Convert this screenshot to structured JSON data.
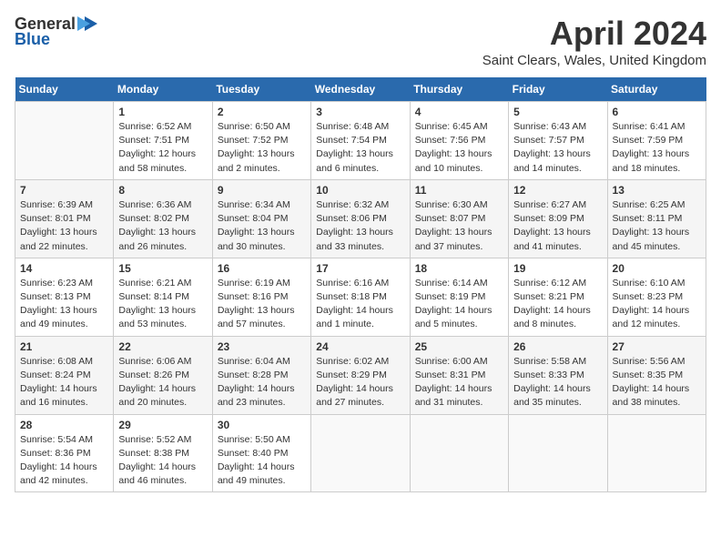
{
  "header": {
    "logo_general": "General",
    "logo_blue": "Blue",
    "title": "April 2024",
    "subtitle": "Saint Clears, Wales, United Kingdom"
  },
  "weekdays": [
    "Sunday",
    "Monday",
    "Tuesday",
    "Wednesday",
    "Thursday",
    "Friday",
    "Saturday"
  ],
  "weeks": [
    [
      {
        "num": "",
        "sunrise": "",
        "sunset": "",
        "daylight": ""
      },
      {
        "num": "1",
        "sunrise": "Sunrise: 6:52 AM",
        "sunset": "Sunset: 7:51 PM",
        "daylight": "Daylight: 12 hours and 58 minutes."
      },
      {
        "num": "2",
        "sunrise": "Sunrise: 6:50 AM",
        "sunset": "Sunset: 7:52 PM",
        "daylight": "Daylight: 13 hours and 2 minutes."
      },
      {
        "num": "3",
        "sunrise": "Sunrise: 6:48 AM",
        "sunset": "Sunset: 7:54 PM",
        "daylight": "Daylight: 13 hours and 6 minutes."
      },
      {
        "num": "4",
        "sunrise": "Sunrise: 6:45 AM",
        "sunset": "Sunset: 7:56 PM",
        "daylight": "Daylight: 13 hours and 10 minutes."
      },
      {
        "num": "5",
        "sunrise": "Sunrise: 6:43 AM",
        "sunset": "Sunset: 7:57 PM",
        "daylight": "Daylight: 13 hours and 14 minutes."
      },
      {
        "num": "6",
        "sunrise": "Sunrise: 6:41 AM",
        "sunset": "Sunset: 7:59 PM",
        "daylight": "Daylight: 13 hours and 18 minutes."
      }
    ],
    [
      {
        "num": "7",
        "sunrise": "Sunrise: 6:39 AM",
        "sunset": "Sunset: 8:01 PM",
        "daylight": "Daylight: 13 hours and 22 minutes."
      },
      {
        "num": "8",
        "sunrise": "Sunrise: 6:36 AM",
        "sunset": "Sunset: 8:02 PM",
        "daylight": "Daylight: 13 hours and 26 minutes."
      },
      {
        "num": "9",
        "sunrise": "Sunrise: 6:34 AM",
        "sunset": "Sunset: 8:04 PM",
        "daylight": "Daylight: 13 hours and 30 minutes."
      },
      {
        "num": "10",
        "sunrise": "Sunrise: 6:32 AM",
        "sunset": "Sunset: 8:06 PM",
        "daylight": "Daylight: 13 hours and 33 minutes."
      },
      {
        "num": "11",
        "sunrise": "Sunrise: 6:30 AM",
        "sunset": "Sunset: 8:07 PM",
        "daylight": "Daylight: 13 hours and 37 minutes."
      },
      {
        "num": "12",
        "sunrise": "Sunrise: 6:27 AM",
        "sunset": "Sunset: 8:09 PM",
        "daylight": "Daylight: 13 hours and 41 minutes."
      },
      {
        "num": "13",
        "sunrise": "Sunrise: 6:25 AM",
        "sunset": "Sunset: 8:11 PM",
        "daylight": "Daylight: 13 hours and 45 minutes."
      }
    ],
    [
      {
        "num": "14",
        "sunrise": "Sunrise: 6:23 AM",
        "sunset": "Sunset: 8:13 PM",
        "daylight": "Daylight: 13 hours and 49 minutes."
      },
      {
        "num": "15",
        "sunrise": "Sunrise: 6:21 AM",
        "sunset": "Sunset: 8:14 PM",
        "daylight": "Daylight: 13 hours and 53 minutes."
      },
      {
        "num": "16",
        "sunrise": "Sunrise: 6:19 AM",
        "sunset": "Sunset: 8:16 PM",
        "daylight": "Daylight: 13 hours and 57 minutes."
      },
      {
        "num": "17",
        "sunrise": "Sunrise: 6:16 AM",
        "sunset": "Sunset: 8:18 PM",
        "daylight": "Daylight: 14 hours and 1 minute."
      },
      {
        "num": "18",
        "sunrise": "Sunrise: 6:14 AM",
        "sunset": "Sunset: 8:19 PM",
        "daylight": "Daylight: 14 hours and 5 minutes."
      },
      {
        "num": "19",
        "sunrise": "Sunrise: 6:12 AM",
        "sunset": "Sunset: 8:21 PM",
        "daylight": "Daylight: 14 hours and 8 minutes."
      },
      {
        "num": "20",
        "sunrise": "Sunrise: 6:10 AM",
        "sunset": "Sunset: 8:23 PM",
        "daylight": "Daylight: 14 hours and 12 minutes."
      }
    ],
    [
      {
        "num": "21",
        "sunrise": "Sunrise: 6:08 AM",
        "sunset": "Sunset: 8:24 PM",
        "daylight": "Daylight: 14 hours and 16 minutes."
      },
      {
        "num": "22",
        "sunrise": "Sunrise: 6:06 AM",
        "sunset": "Sunset: 8:26 PM",
        "daylight": "Daylight: 14 hours and 20 minutes."
      },
      {
        "num": "23",
        "sunrise": "Sunrise: 6:04 AM",
        "sunset": "Sunset: 8:28 PM",
        "daylight": "Daylight: 14 hours and 23 minutes."
      },
      {
        "num": "24",
        "sunrise": "Sunrise: 6:02 AM",
        "sunset": "Sunset: 8:29 PM",
        "daylight": "Daylight: 14 hours and 27 minutes."
      },
      {
        "num": "25",
        "sunrise": "Sunrise: 6:00 AM",
        "sunset": "Sunset: 8:31 PM",
        "daylight": "Daylight: 14 hours and 31 minutes."
      },
      {
        "num": "26",
        "sunrise": "Sunrise: 5:58 AM",
        "sunset": "Sunset: 8:33 PM",
        "daylight": "Daylight: 14 hours and 35 minutes."
      },
      {
        "num": "27",
        "sunrise": "Sunrise: 5:56 AM",
        "sunset": "Sunset: 8:35 PM",
        "daylight": "Daylight: 14 hours and 38 minutes."
      }
    ],
    [
      {
        "num": "28",
        "sunrise": "Sunrise: 5:54 AM",
        "sunset": "Sunset: 8:36 PM",
        "daylight": "Daylight: 14 hours and 42 minutes."
      },
      {
        "num": "29",
        "sunrise": "Sunrise: 5:52 AM",
        "sunset": "Sunset: 8:38 PM",
        "daylight": "Daylight: 14 hours and 46 minutes."
      },
      {
        "num": "30",
        "sunrise": "Sunrise: 5:50 AM",
        "sunset": "Sunset: 8:40 PM",
        "daylight": "Daylight: 14 hours and 49 minutes."
      },
      {
        "num": "",
        "sunrise": "",
        "sunset": "",
        "daylight": ""
      },
      {
        "num": "",
        "sunrise": "",
        "sunset": "",
        "daylight": ""
      },
      {
        "num": "",
        "sunrise": "",
        "sunset": "",
        "daylight": ""
      },
      {
        "num": "",
        "sunrise": "",
        "sunset": "",
        "daylight": ""
      }
    ]
  ]
}
